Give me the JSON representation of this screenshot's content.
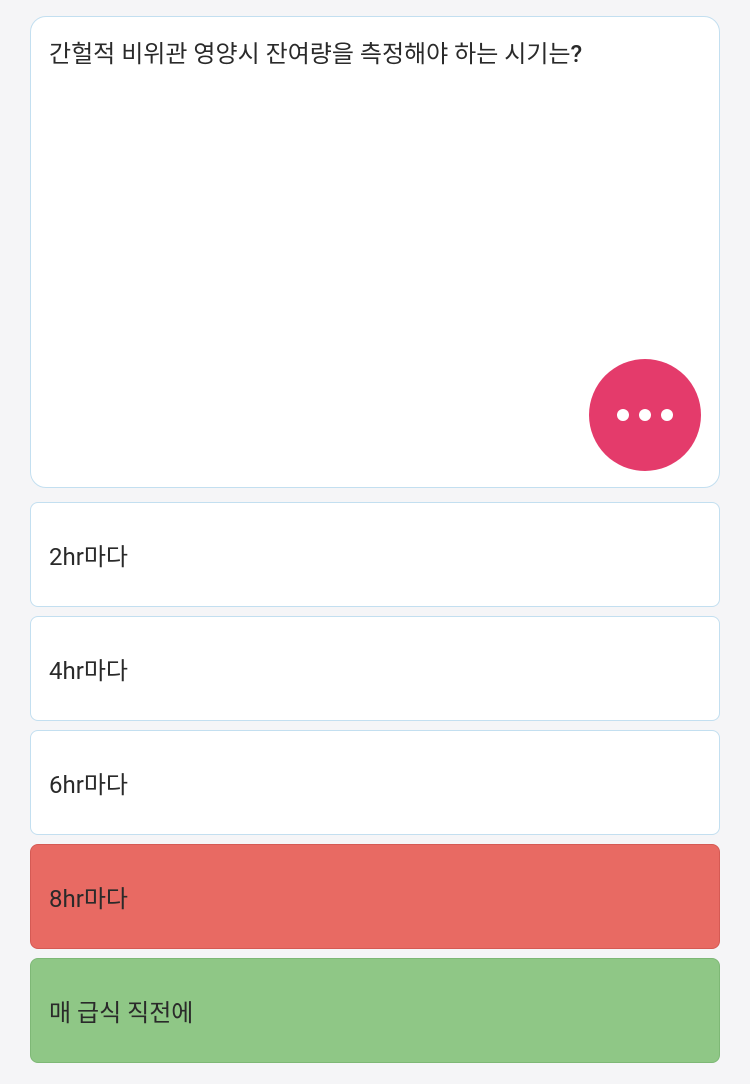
{
  "question": {
    "text": "간헐적 비위관 영양시 잔여량을 측정해야 하는 시기는?"
  },
  "options": [
    {
      "label": "2hr마다",
      "state": "neutral"
    },
    {
      "label": "4hr마다",
      "state": "neutral"
    },
    {
      "label": "6hr마다",
      "state": "neutral"
    },
    {
      "label": "8hr마다",
      "state": "wrong"
    },
    {
      "label": "매 급식 직전에",
      "state": "correct"
    }
  ],
  "colors": {
    "accent": "#e43b6b",
    "wrong": "#e86a63",
    "correct": "#8fc786",
    "border": "#c3dff0"
  }
}
